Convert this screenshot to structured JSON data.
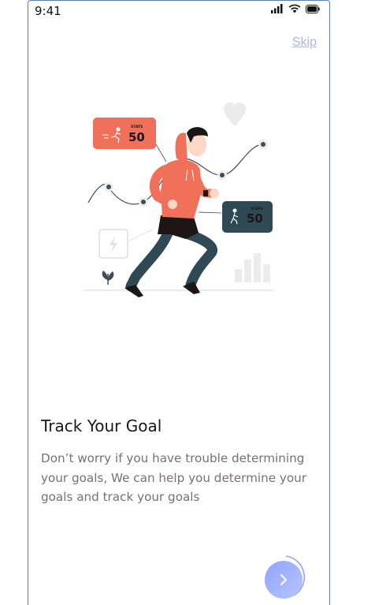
{
  "status_bar": {
    "time": "9:41"
  },
  "header": {
    "skip_label": "Skip"
  },
  "onboarding": {
    "title": "Track Your Goal",
    "description": "Don’t worry if you have trouble determining your goals, We can help you determine your goals and track your goals"
  },
  "illustration": {
    "stats_label": "STATS",
    "card_left_value": "50",
    "card_right_value": "50"
  },
  "colors": {
    "accent": "#92A3FD",
    "accent_light": "#C5D0FF",
    "runner_shirt": "#F0705A",
    "runner_pants": "#2F4A55",
    "text_dark": "#1D1617",
    "text_gray": "#7B6F72"
  },
  "icons": {
    "next": "chevron-right-icon",
    "signal": "signal-icon",
    "wifi": "wifi-icon",
    "battery": "battery-icon"
  }
}
